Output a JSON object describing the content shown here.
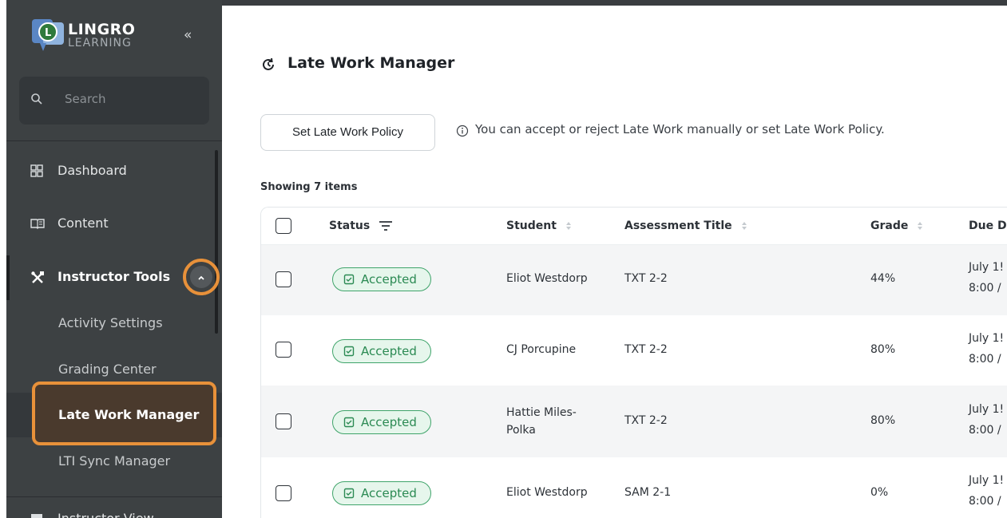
{
  "brand": {
    "name_line1": "LINGRO",
    "name_line2": "LEARNING",
    "collapse_glyph": "«"
  },
  "search": {
    "placeholder": "Search"
  },
  "nav": {
    "dashboard": "Dashboard",
    "content": "Content",
    "instructor_tools": "Instructor Tools",
    "sub_items": [
      "Activity Settings",
      "Grading Center",
      "Late Work Manager",
      "LTI Sync Manager"
    ],
    "next_partial": "Instructor View"
  },
  "colors": {
    "accent_orange": "#e8913a",
    "sidebar_bg": "#3d4143",
    "badge_green": "#3fa46a"
  },
  "main": {
    "title": "Late Work Manager",
    "policy_button": "Set Late Work Policy",
    "info_text": "You can accept or reject Late Work manually or set Late Work Policy.",
    "showing": "Showing 7 items"
  },
  "table": {
    "headers": {
      "status": "Status",
      "student": "Student",
      "assessment": "Assessment Title",
      "grade": "Grade",
      "due": "Due D"
    },
    "rows": [
      {
        "status": "Accepted",
        "student": "Eliot Westdorp",
        "assessment": "TXT 2-2",
        "grade": "44%",
        "due_line1": "July 1!",
        "due_line2": "8:00 /"
      },
      {
        "status": "Accepted",
        "student": "CJ Porcupine",
        "assessment": "TXT 2-2",
        "grade": "80%",
        "due_line1": "July 1!",
        "due_line2": "8:00 /"
      },
      {
        "status": "Accepted",
        "student": "Hattie Miles-Polka",
        "assessment": "TXT 2-2",
        "grade": "80%",
        "due_line1": "July 1!",
        "due_line2": "8:00 /"
      },
      {
        "status": "Accepted",
        "student": "Eliot Westdorp",
        "assessment": "SAM 2-1",
        "grade": "0%",
        "due_line1": "July 1!",
        "due_line2": "8:00 /"
      }
    ]
  }
}
